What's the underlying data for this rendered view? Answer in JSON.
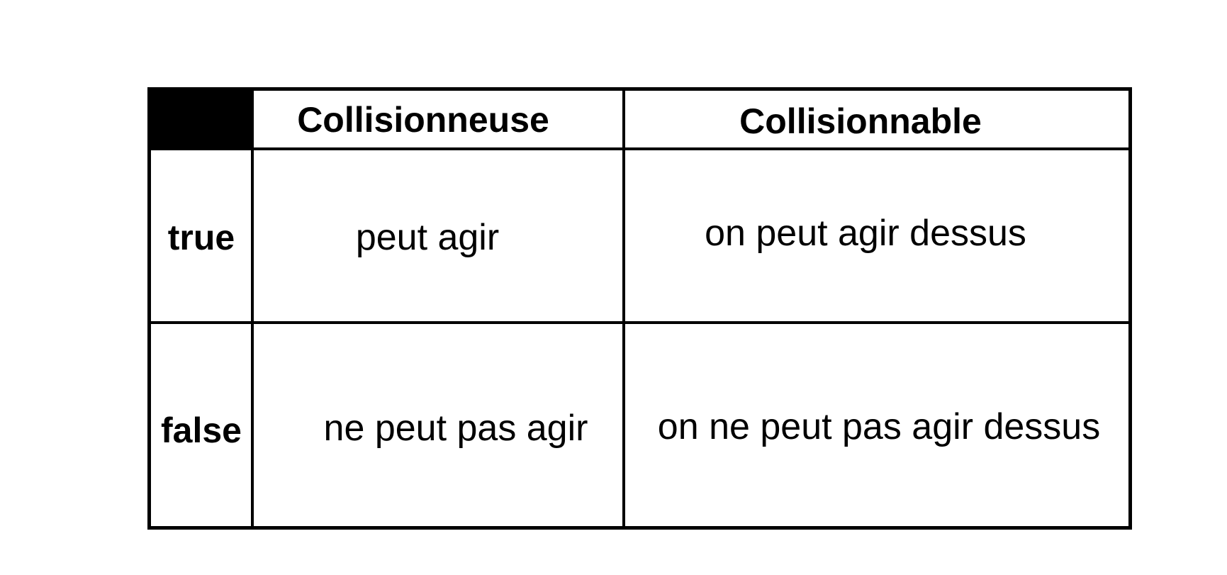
{
  "table": {
    "headers": [
      "Collisionneuse",
      "Collisionnable"
    ],
    "rows": [
      {
        "label": "true",
        "cells": [
          "peut agir",
          "on peut agir dessus"
        ]
      },
      {
        "label": "false",
        "cells": [
          "ne peut pas agir",
          "on ne peut pas agir dessus"
        ]
      }
    ]
  }
}
